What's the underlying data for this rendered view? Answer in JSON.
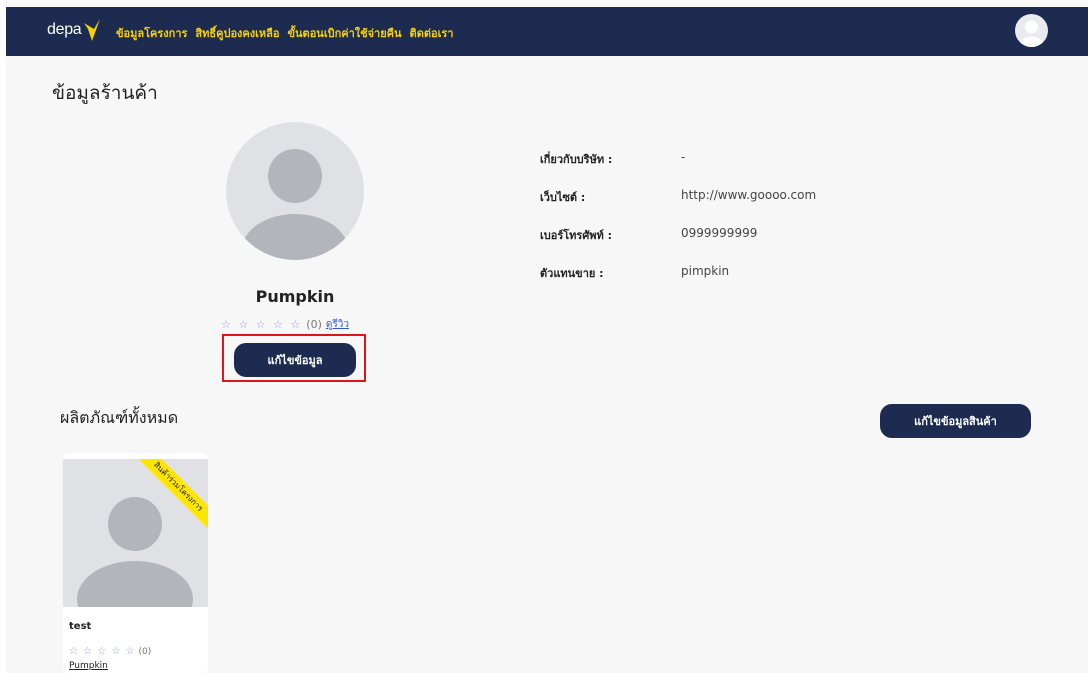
{
  "navbar": {
    "logo_text": "depa",
    "links": [
      "ข้อมูลโครงการ",
      "สิทธิ์คูปองคงเหลือ",
      "ขั้นตอนเบิกค่าใช้จ่ายคืน",
      "ติดต่อเรา"
    ],
    "accent_color": "#f5d10a",
    "background_color": "#1c2b4f",
    "user_icon": "user-avatar-icon"
  },
  "page": {
    "title": "ข้อมูลร้านค้า"
  },
  "shop": {
    "avatar_icon": "user-placeholder-icon",
    "name": "Pumpkin",
    "stars": "☆ ☆ ☆ ☆ ☆",
    "rating_count": "(0)",
    "review_link": "ดูรีวิว",
    "edit_button": "แก้ไขข้อมูล",
    "info": [
      {
        "label": "เกี่ยวกับบริษัท :",
        "value": "-"
      },
      {
        "label": "เว็บไซต์ :",
        "value": "http://www.goooo.com"
      },
      {
        "label": "เบอร์โทรศัพท์ :",
        "value": "0999999999"
      },
      {
        "label": "ตัวแทนขาย :",
        "value": "pimpkin"
      }
    ]
  },
  "products": {
    "section_title": "ผลิตภัณฑ์ทั้งหมด",
    "edit_button": "แก้ไขข้อมูลสินค้า",
    "items": [
      {
        "ribbon": "สินค้าร่วมโครงการ",
        "name": "test",
        "stars": "☆ ☆ ☆ ☆ ☆",
        "rating_count": "(0)",
        "shop": "Pumpkin"
      }
    ]
  }
}
